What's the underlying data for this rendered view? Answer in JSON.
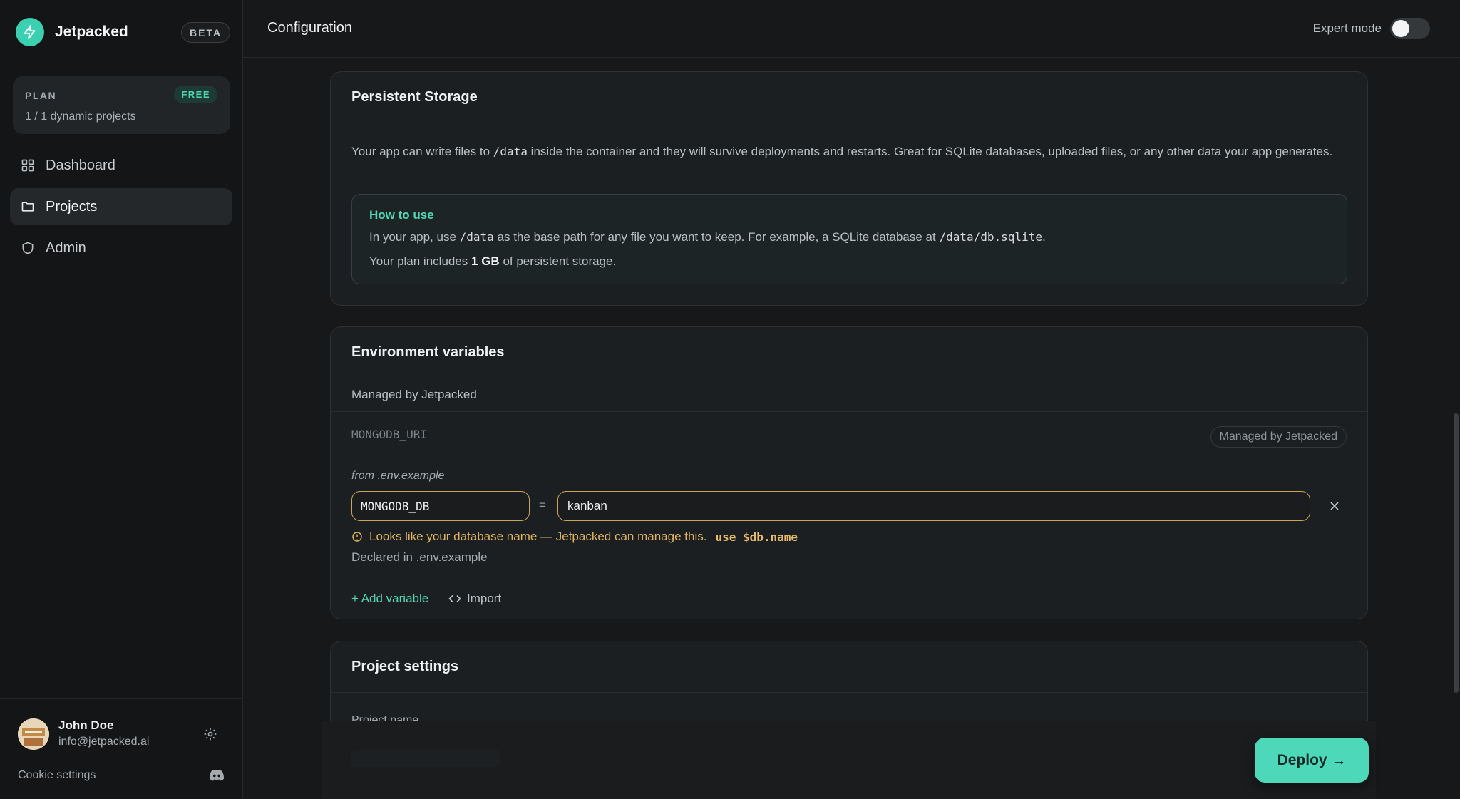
{
  "brand": {
    "name": "Jetpacked",
    "badge": "BETA",
    "accent": "#3ad0b0"
  },
  "plan": {
    "label": "PLAN",
    "tier": "FREE",
    "usage": "1 / 1 dynamic projects"
  },
  "nav": [
    {
      "label": "Dashboard",
      "icon": "grid-icon",
      "active": false
    },
    {
      "label": "Projects",
      "icon": "folder-icon",
      "active": true
    },
    {
      "label": "Admin",
      "icon": "shield-icon",
      "active": false
    }
  ],
  "user": {
    "name": "John Doe",
    "email": "info@jetpacked.ai",
    "cookie_label": "Cookie settings"
  },
  "header": {
    "title": "Configuration",
    "expert_label": "Expert mode",
    "expert_on": false
  },
  "storage": {
    "title": "Persistent Storage",
    "desc_pre": "Your app can write files to ",
    "desc_code": "/data",
    "desc_post": " inside the container and they will survive deployments and restarts. Great for SQLite databases, uploaded files, or any other data your app generates.",
    "howto_title": "How to use",
    "howto_1a": "In your app, use ",
    "howto_1b": "/data",
    "howto_1c": " as the base path for any file you want to keep. For example, a SQLite database at ",
    "howto_1d": "/data/db.sqlite",
    "howto_1e": ".",
    "howto_2a": "Your plan includes ",
    "howto_2b": "1 GB",
    "howto_2c": " of persistent storage."
  },
  "env": {
    "title": "Environment variables",
    "managed_header": "Managed by Jetpacked",
    "managed_key": "MONGODB_URI",
    "managed_badge": "Managed by Jetpacked",
    "from_label": "from .env.example",
    "key_value": "MONGODB_DB",
    "eq": "=",
    "value_value": "kanban",
    "warning": "Looks like your database name — Jetpacked can manage this.",
    "warning_link": "use $db.name",
    "declared": "Declared in .env.example",
    "add_label": "+ Add variable",
    "import_label": "Import"
  },
  "project": {
    "title": "Project settings",
    "name_label": "Project name"
  },
  "deploy_label": "Deploy →"
}
